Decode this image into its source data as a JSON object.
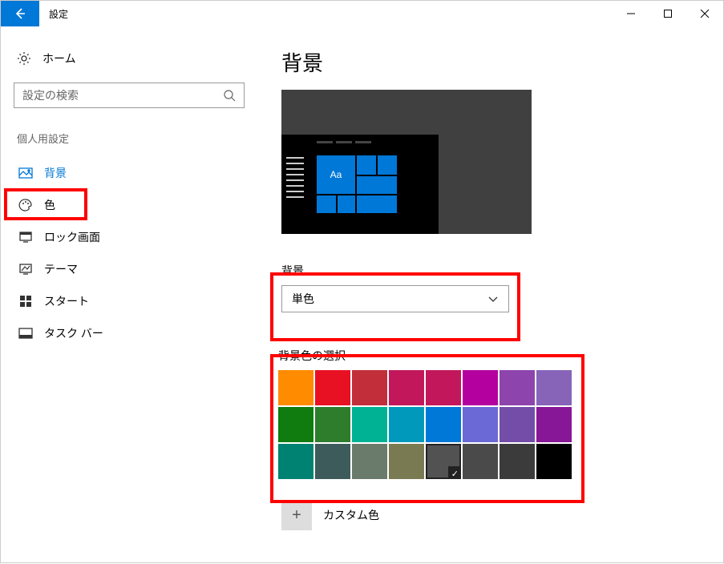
{
  "window": {
    "title": "設定"
  },
  "sidebar": {
    "home": "ホーム",
    "search_placeholder": "設定の検索",
    "category": "個人用設定",
    "items": [
      {
        "label": "背景",
        "icon": "picture-icon",
        "active": true
      },
      {
        "label": "色",
        "icon": "palette-icon"
      },
      {
        "label": "ロック画面",
        "icon": "lockscreen-icon"
      },
      {
        "label": "テーマ",
        "icon": "theme-icon"
      },
      {
        "label": "スタート",
        "icon": "start-icon"
      },
      {
        "label": "タスク バー",
        "icon": "taskbar-icon"
      }
    ]
  },
  "main": {
    "title": "背景",
    "preview_sample": "Aa",
    "bg_section_label": "背景",
    "bg_dropdown_value": "単色",
    "color_section_label": "背景色の選択",
    "custom_color_label": "カスタム色",
    "colors": [
      "#ff8c00",
      "#e81123",
      "#c22f3a",
      "#c2185b",
      "#c2185b",
      "#b4009e",
      "#8e44ad",
      "#8764b8",
      "#107c10",
      "#2d7d2d",
      "#00b294",
      "#0099bc",
      "#0078d7",
      "#6b69d6",
      "#744da9",
      "#881798",
      "#008272",
      "#3e5b5b",
      "#6b7b6b",
      "#7a7a52",
      "#525252",
      "#4a4a4a",
      "#3b3b3b",
      "#000000"
    ],
    "selected_color_index": 20
  }
}
